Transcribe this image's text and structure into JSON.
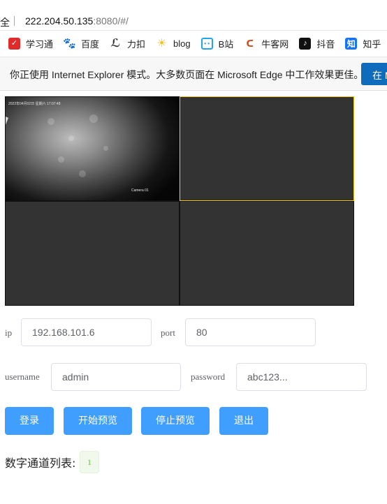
{
  "browser": {
    "security_text": "全",
    "url_host": "222.204.50.135",
    "url_rest": ":8080/#/"
  },
  "bookmarks": [
    {
      "label": "学习通",
      "icon": "xuexitong-icon",
      "glyph": "✓"
    },
    {
      "label": "百度",
      "icon": "baidu-paw-icon",
      "glyph": "🐾"
    },
    {
      "label": "力扣",
      "icon": "leetcode-icon",
      "glyph": "ℒ"
    },
    {
      "label": "blog",
      "icon": "sun-icon",
      "glyph": "☀"
    },
    {
      "label": "B站",
      "icon": "bilibili-icon",
      "glyph": "• •"
    },
    {
      "label": "牛客网",
      "icon": "nowcoder-icon",
      "glyph": "ᑕ"
    },
    {
      "label": "抖音",
      "icon": "douyin-icon",
      "glyph": "♪"
    },
    {
      "label": "知乎",
      "icon": "zhihu-icon",
      "glyph": "知"
    },
    {
      "label": "",
      "icon": "bookmark-icon",
      "glyph": "[⌐"
    }
  ],
  "ie_banner": {
    "message": "你正使用 Internet Explorer 模式。大多数页面在 Microsoft Edge 中工作效果更佳。",
    "button": "在 M"
  },
  "video": {
    "osd_text": "2022年04月02日 星期六 17:07:48",
    "camera_label": "Camera 01"
  },
  "form": {
    "ip_label": "ip",
    "ip_value": "192.168.101.6",
    "port_label": "port",
    "port_value": "80",
    "username_label": "username",
    "username_value": "admin",
    "password_label": "password",
    "password_value": "abc123..."
  },
  "buttons": {
    "login": "登录",
    "start_preview": "开始预览",
    "stop_preview": "停止预览",
    "logout": "退出"
  },
  "channels": {
    "label": "数字通道列表:",
    "items": [
      "1"
    ]
  },
  "colors": {
    "primary": "#409eff",
    "selected_border": "#f3c617",
    "tag_success": "#67c23a"
  }
}
